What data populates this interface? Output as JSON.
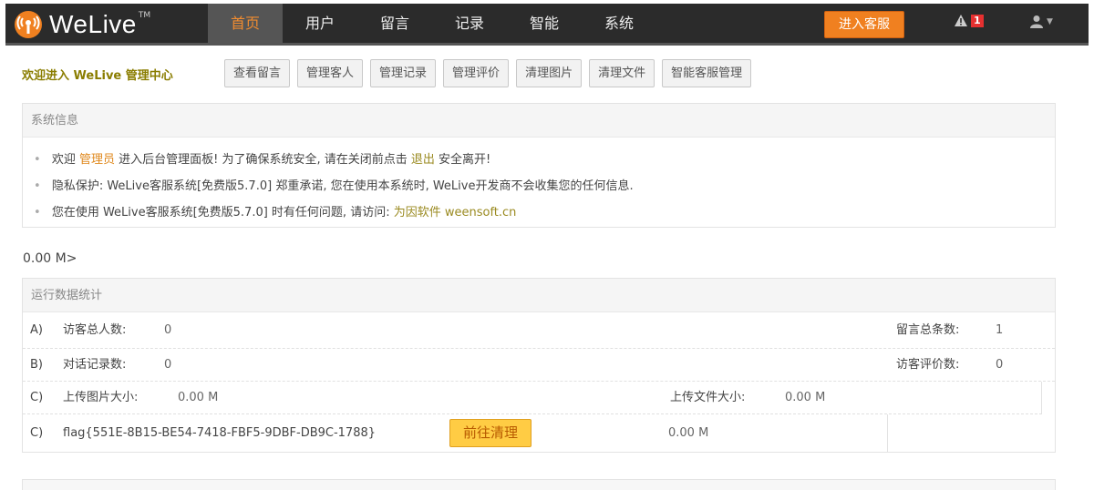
{
  "brand": {
    "name": "WeLive",
    "tm": "TM"
  },
  "nav": {
    "items": [
      {
        "label": "首页",
        "active": true
      },
      {
        "label": "用户",
        "active": false
      },
      {
        "label": "留言",
        "active": false
      },
      {
        "label": "记录",
        "active": false
      },
      {
        "label": "智能",
        "active": false
      },
      {
        "label": "系统",
        "active": false
      }
    ],
    "enter_label": "进入客服",
    "alert_count": "1"
  },
  "welcome": "欢迎进入 WeLive 管理中心",
  "quick_links": [
    "查看留言",
    "管理客人",
    "管理记录",
    "管理评价",
    "清理图片",
    "清理文件",
    "智能客服管理"
  ],
  "system_info": {
    "title": "系统信息",
    "line1": {
      "p1": "欢迎",
      "role": "管理员",
      "p2": "进入后台管理面板! 为了确保系统安全, 请在关闭前点击",
      "logout": "退出",
      "p3": "安全离开!"
    },
    "line2": "隐私保护: WeLive客服系统[免费版5.7.0] 郑重承诺, 您在使用本系统时, WeLive开发商不会收集您的任何信息.",
    "line3": {
      "p1": "您在使用 WeLive客服系统[免费版5.7.0] 时有任何问题, 请访问:",
      "link": "为因软件 weensoft.cn"
    }
  },
  "storage_text": "0.00 M>",
  "stats": {
    "title": "运行数据统计",
    "row1": {
      "letter": "A)",
      "label": "访客总人数:",
      "value": "0",
      "label2": "留言总条数:",
      "value2": "1"
    },
    "row2": {
      "letter": "B)",
      "label": "对话记录数:",
      "value": "0",
      "label2": "访客评价数:",
      "value2": "0"
    },
    "row3": {
      "letter": "C)",
      "label": "上传图片大小:",
      "value": "0.00 M",
      "label2": "上传文件大小:",
      "value2": "0.00 M"
    },
    "row4": {
      "letter": "C)",
      "flag": "flag{551E-8B15-BE54-7418-FBF5-9DBF-DB9C-1788}",
      "button": "前往清理",
      "value": "0.00 M"
    }
  },
  "colors": {
    "accent": "#f08020",
    "nav_bg": "#2b2b2b",
    "highlight": "#e08a20",
    "olive": "#9a8a20"
  }
}
